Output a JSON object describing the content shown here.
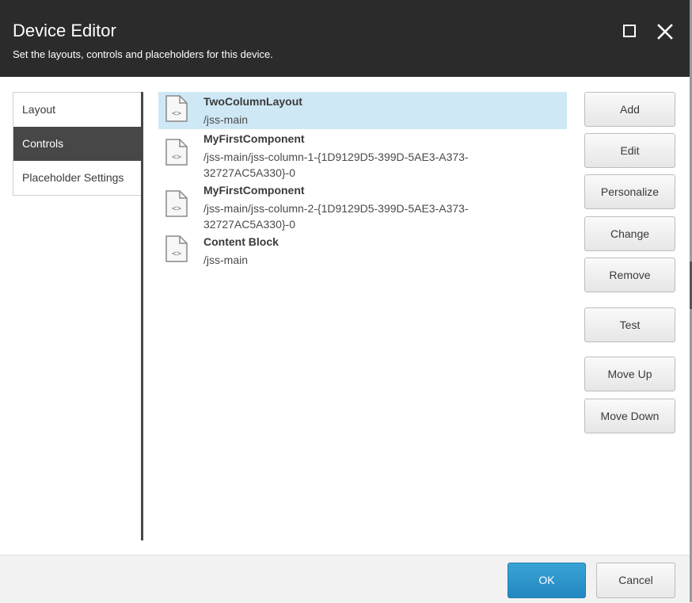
{
  "dialog": {
    "title": "Device Editor",
    "subtitle": "Set the layouts, controls and placeholders for this device."
  },
  "window_controls": {
    "maximize_icon": "maximize-icon",
    "close_icon": "close-icon"
  },
  "nav": {
    "items": [
      {
        "label": "Layout",
        "active": false
      },
      {
        "label": "Controls",
        "active": true
      },
      {
        "label": "Placeholder Settings",
        "active": false
      }
    ]
  },
  "controls": [
    {
      "name": "TwoColumnLayout",
      "path": "/jss-main",
      "selected": true,
      "icon": "code-file-icon"
    },
    {
      "name": "MyFirstComponent",
      "path": "/jss-main/jss-column-1-{1D9129D5-399D-5AE3-A373-32727AC5A330}-0",
      "selected": false,
      "icon": "code-file-icon"
    },
    {
      "name": "MyFirstComponent",
      "path": "/jss-main/jss-column-2-{1D9129D5-399D-5AE3-A373-32727AC5A330}-0",
      "selected": false,
      "icon": "code-file-icon"
    },
    {
      "name": "Content Block",
      "path": "/jss-main",
      "selected": false,
      "icon": "code-file-icon"
    }
  ],
  "actions": {
    "add": "Add",
    "edit": "Edit",
    "personalize": "Personalize",
    "change": "Change",
    "remove": "Remove",
    "test": "Test",
    "move_up": "Move Up",
    "move_down": "Move Down"
  },
  "footer": {
    "ok": "OK",
    "cancel": "Cancel"
  },
  "colors": {
    "header_bg": "#2b2b2b",
    "selected_row": "#cfe8f5",
    "primary": "#2a90c8",
    "nav_active": "#474747"
  }
}
